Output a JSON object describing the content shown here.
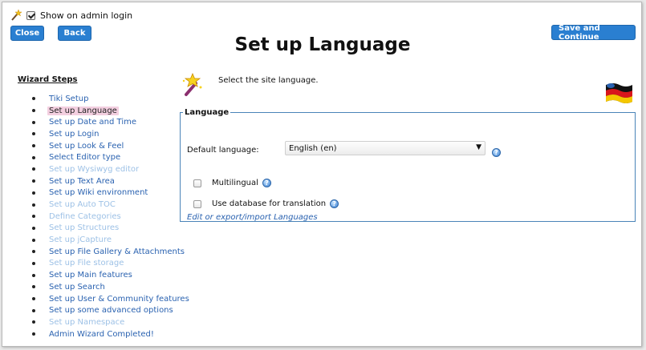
{
  "topbar": {
    "wand_icon": "magic-wand-icon",
    "show_on_login_label": "Show on admin login",
    "show_on_login_checked": true
  },
  "buttons": {
    "close": "Close",
    "back": "Back",
    "save": "Save and Continue"
  },
  "page_title": "Set up Language",
  "sidebar": {
    "title": "Wizard Steps",
    "items": [
      {
        "label": "Tiki Setup",
        "state": "link"
      },
      {
        "label": "Set up Language",
        "state": "current"
      },
      {
        "label": "Set up Date and Time",
        "state": "link"
      },
      {
        "label": "Set up Login",
        "state": "link"
      },
      {
        "label": "Set up Look & Feel",
        "state": "link"
      },
      {
        "label": "Select Editor type",
        "state": "link"
      },
      {
        "label": "Set up Wysiwyg editor",
        "state": "disabled"
      },
      {
        "label": "Set up Text Area",
        "state": "link"
      },
      {
        "label": "Set up Wiki environment",
        "state": "link"
      },
      {
        "label": "Set up Auto TOC",
        "state": "disabled"
      },
      {
        "label": "Define Categories",
        "state": "disabled"
      },
      {
        "label": "Set up Structures",
        "state": "disabled"
      },
      {
        "label": "Set up jCapture",
        "state": "disabled"
      },
      {
        "label": "Set up File Gallery & Attachments",
        "state": "link"
      },
      {
        "label": "Set up File storage",
        "state": "disabled"
      },
      {
        "label": "Set up Main features",
        "state": "link"
      },
      {
        "label": "Set up Search",
        "state": "link"
      },
      {
        "label": "Set up User & Community features",
        "state": "link"
      },
      {
        "label": "Set up some advanced options",
        "state": "link"
      },
      {
        "label": "Set up Namespace",
        "state": "disabled"
      },
      {
        "label": "Admin Wizard Completed!",
        "state": "link"
      }
    ]
  },
  "main": {
    "intro": "Select the site language.",
    "fieldset_legend": "Language",
    "default_language_label": "Default language:",
    "default_language_value": "English (en)",
    "multilingual_label": "Multilingual",
    "multilingual_checked": false,
    "db_translation_label": "Use database for translation",
    "db_translation_checked": false,
    "edit_link": "Edit or export/import Languages"
  },
  "colors": {
    "button_blue": "#2a7fd1",
    "link_blue": "#2a62b0",
    "disabled_link": "#9dc1e6",
    "current_highlight": "#f3cfe0",
    "fieldset_border": "#4a84b8"
  }
}
